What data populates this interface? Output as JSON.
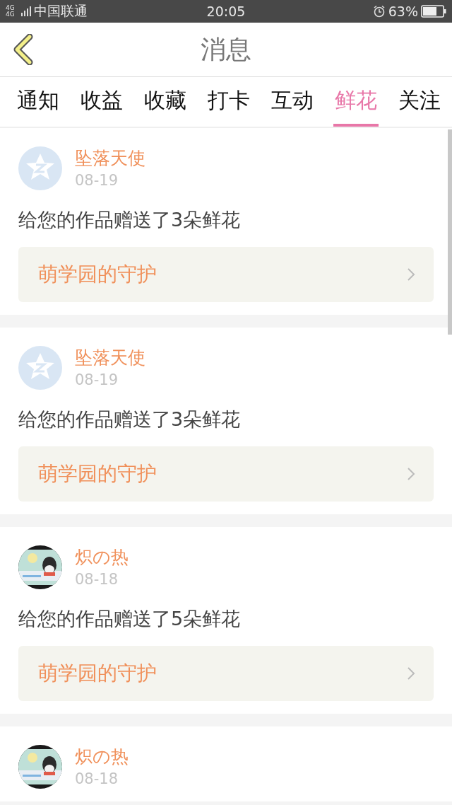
{
  "status_bar": {
    "network": "4G 4G",
    "carrier": "中国联通",
    "time": "20:05",
    "battery": "63%"
  },
  "header": {
    "title": "消息"
  },
  "tabs": [
    {
      "label": "通知",
      "selected": false
    },
    {
      "label": "收益",
      "selected": false
    },
    {
      "label": "收藏",
      "selected": false
    },
    {
      "label": "打卡",
      "selected": false
    },
    {
      "label": "互动",
      "selected": false
    },
    {
      "label": "鲜花",
      "selected": true
    },
    {
      "label": "关注",
      "selected": false
    }
  ],
  "messages": [
    {
      "avatar": {
        "kind": "default"
      },
      "name": "坠落天使",
      "date": "08-19",
      "text": "给您的作品赠送了3朵鲜花",
      "link": "萌学园的守护"
    },
    {
      "avatar": {
        "kind": "default"
      },
      "name": "坠落天使",
      "date": "08-19",
      "text": "给您的作品赠送了3朵鲜花",
      "link": "萌学园的守护"
    },
    {
      "name": "炽の热",
      "date": "08-18",
      "text": "给您的作品赠送了5朵鲜花",
      "link": "萌学园的守护"
    },
    {
      "name": "炽の热",
      "date": "08-18"
    }
  ]
}
